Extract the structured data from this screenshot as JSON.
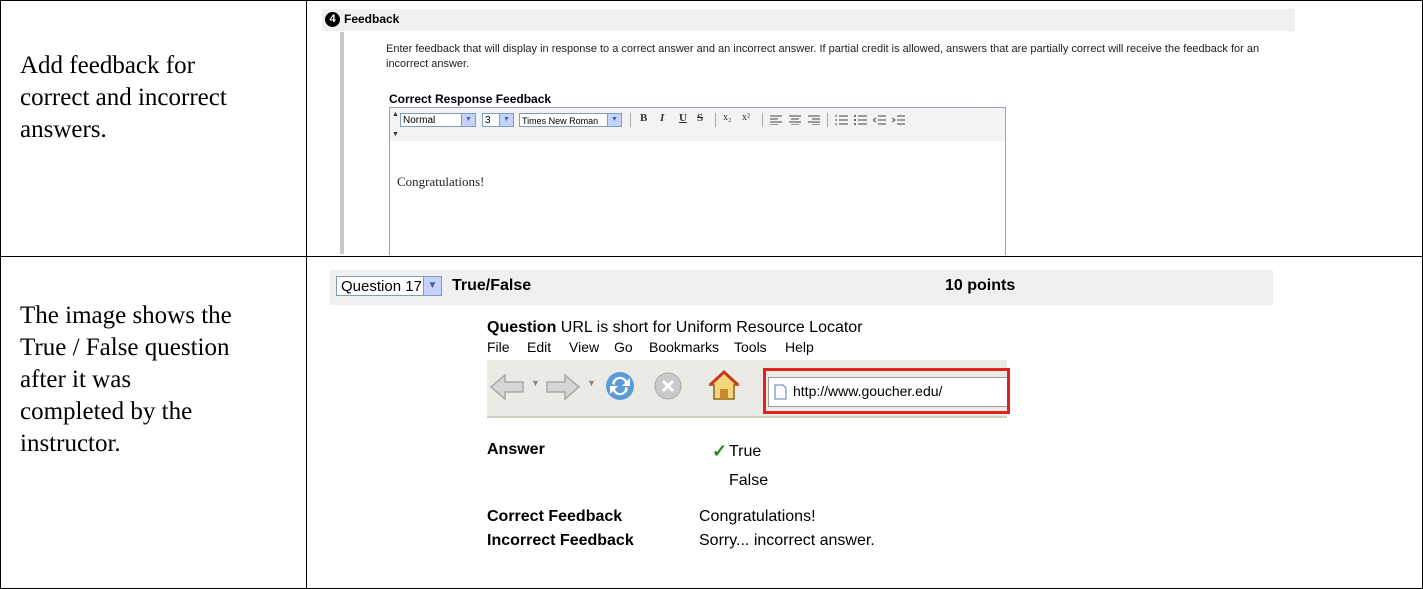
{
  "rows": [
    {
      "instruction": [
        "Add feedback for",
        "correct and incorrect",
        "answers."
      ],
      "panel": {
        "step_number": "4",
        "section_title": "Feedback",
        "description": "Enter feedback that will display in response to a correct answer and an incorrect answer. If partial credit is allowed, answers that are partially correct will receive the feedback for an incorrect answer.",
        "field_label": "Correct Response Feedback",
        "toolbar": {
          "style_value": "Normal",
          "size_value": "3",
          "font_value": "Times New Roman",
          "buttons": [
            "B",
            "I",
            "U",
            "S",
            "x₂",
            "x²"
          ]
        },
        "editor_content": "Congratulations!"
      }
    },
    {
      "instruction": [
        "The image shows the",
        "True / False question",
        "after it was",
        "completed by the",
        "instructor."
      ],
      "panel": {
        "question_select": "Question 17",
        "question_type": "True/False",
        "points": "10 points",
        "question_label": "Question",
        "question_text": "URL is short for Uniform Resource Locator",
        "browser_menu": [
          "File",
          "Edit",
          "View",
          "Go",
          "Bookmarks",
          "Tools",
          "Help"
        ],
        "url": "http://www.goucher.edu/",
        "answer_label": "Answer",
        "answers": [
          "True",
          "False"
        ],
        "correct_answer_mark": "✓",
        "correct_feedback_label": "Correct Feedback",
        "correct_feedback": "Congratulations!",
        "incorrect_feedback_label": "Incorrect Feedback",
        "incorrect_feedback": "Sorry... incorrect answer."
      }
    }
  ],
  "colors": {
    "highlight_border": "#e2221e",
    "check_green": "#1b8a1b",
    "header_bg": "#f0f0f0"
  }
}
